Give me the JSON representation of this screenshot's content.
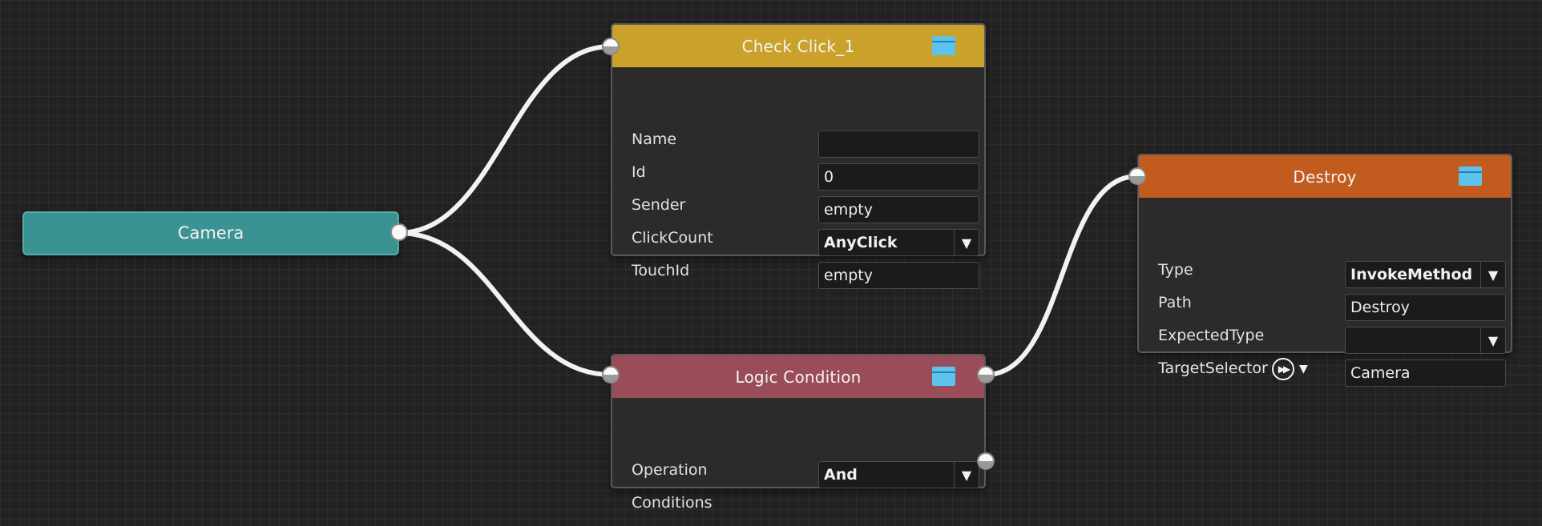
{
  "colors": {
    "canvas_bg": "#222222",
    "camera_node": "#3a9392",
    "check_click_header": "#c9a12b",
    "logic_condition_header": "#9a4d58",
    "destroy_header": "#c25b1e",
    "node_body": "#2b2b2b",
    "wire": "#f2f2f2",
    "collapse_icon": "#5cc3ef"
  },
  "icons": {
    "collapse": "collapse-icon",
    "dropdown": "triangle-down-icon",
    "port": "connector-port-icon",
    "selector": "fast-forward-circle-icon"
  },
  "camera_node": {
    "title": "Camera"
  },
  "check_click_node": {
    "title": "Check Click_1",
    "fields": [
      {
        "label": "Name",
        "value": ""
      },
      {
        "label": "Id",
        "value": "0"
      },
      {
        "label": "Sender",
        "value": "empty"
      },
      {
        "label": "ClickCount",
        "value": "AnyClick"
      },
      {
        "label": "TouchId",
        "value": "empty"
      }
    ]
  },
  "logic_condition_node": {
    "title": "Logic Condition",
    "fields": [
      {
        "label": "Operation",
        "value": "And"
      },
      {
        "label": "Conditions"
      }
    ]
  },
  "destroy_node": {
    "title": "Destroy",
    "fields": [
      {
        "label": "Type",
        "value": "InvokeMethod"
      },
      {
        "label": "Path",
        "value": "Destroy"
      },
      {
        "label": "ExpectedType",
        "value": ""
      },
      {
        "label": "TargetSelector",
        "value": "Camera"
      }
    ]
  }
}
